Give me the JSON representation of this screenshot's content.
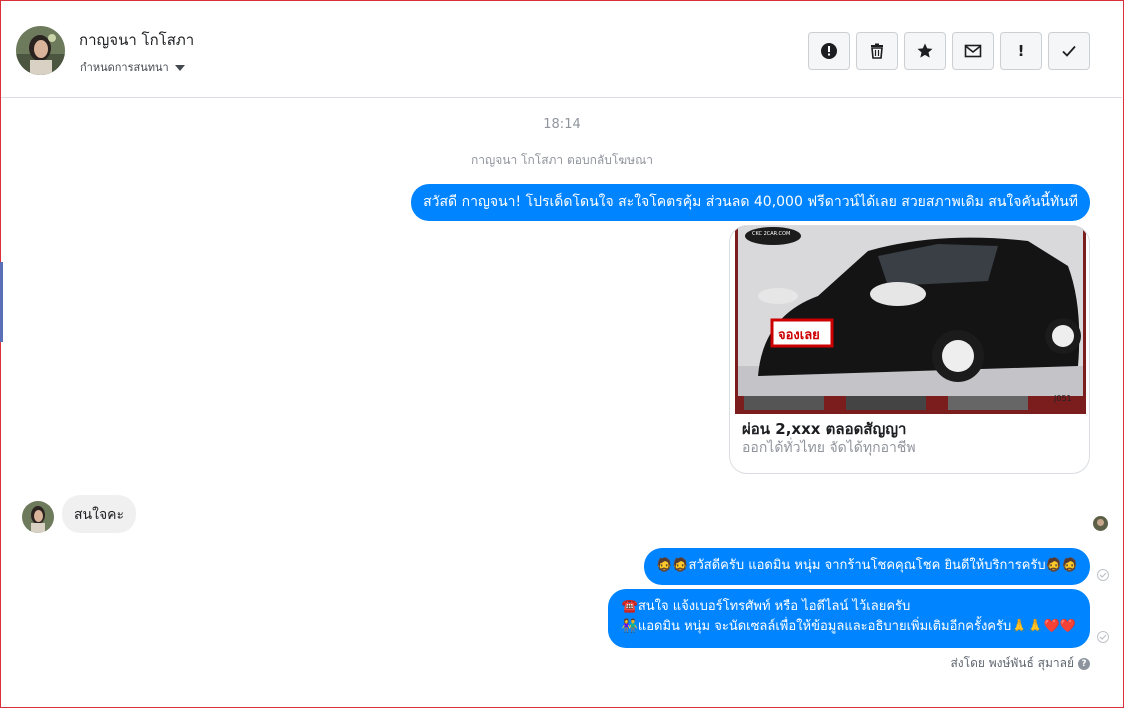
{
  "header": {
    "contact_name": "กาญจนา โกโสภา",
    "conversation_settings": "กำหนดการสนทนา",
    "actions": [
      {
        "name": "report-spam",
        "icon": "alert-circle-icon"
      },
      {
        "name": "delete",
        "icon": "trash-icon"
      },
      {
        "name": "star",
        "icon": "star-icon"
      },
      {
        "name": "mark-unread",
        "icon": "envelope-icon"
      },
      {
        "name": "follow-up",
        "icon": "exclamation-icon",
        "label": "!"
      },
      {
        "name": "mark-done",
        "icon": "check-icon"
      }
    ]
  },
  "thread": {
    "timestamp": "18:14",
    "ad_reply_note": "กาญจนา โกโสภา ตอบกลับโฆษณา",
    "messages": {
      "outgoing_1": "สวัสดี กาญจนา! โปรเด็ดโดนใจ สะใจโคตรคุ้ม ส่วนลด 40,000 ฟรีดาวน์ได้เลย สวยสภาพเดิม สนใจคันนี้ทันที",
      "card": {
        "title": "ผ่อน 2,xxx ตลอดสัญญา",
        "subtitle": "ออกได้ทั่วไทย จัดได้ทุกอาชีพ",
        "image_badge": "จองเลย",
        "image_watermark": "CKC 2CAR.COM",
        "image_code": "J051"
      },
      "incoming_1": "สนใจคะ",
      "outgoing_2": "🧔🧔สวัสดีครับ แอดมิน หนุ่ม จากร้านโชคคุณโชค ยินดีให้บริการครับ🧔🧔",
      "outgoing_3_line1": "☎️สนใจ แจ้งเบอร์โทรศัพท์ หรือ ไอดีไลน์  ไว้เลยครับ",
      "outgoing_3_line2": "👫แอดมิน หนุ่ม จะนัดเซลล์เพื่อให้ข้อมูลและอธิบายเพิ่มเติมอีกครั้งครับ🙏🙏❤️❤️"
    },
    "sent_by": "ส่งโดย พงษ์พันธ์ สุมาลย์",
    "help_glyph": "?"
  },
  "colors": {
    "outgoing_bubble": "#0084ff",
    "incoming_bubble": "#f1f0f0",
    "frame_border": "#d9303b"
  }
}
